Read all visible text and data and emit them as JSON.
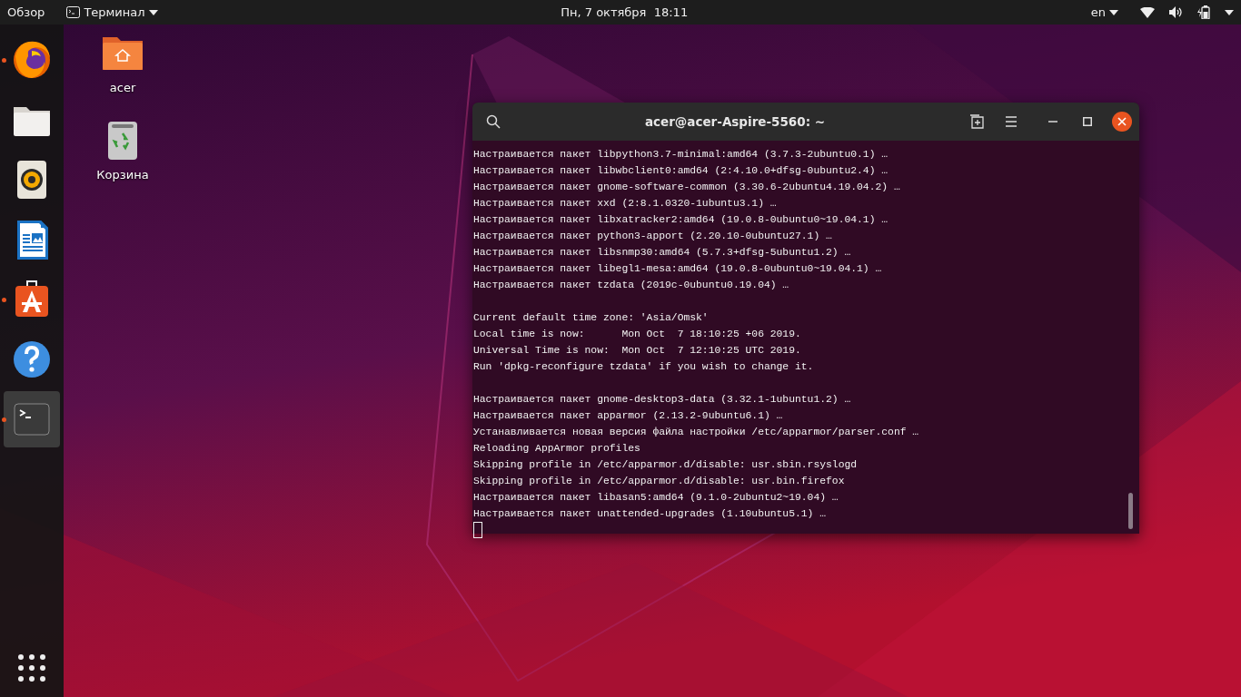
{
  "top_bar": {
    "activities": "Обзор",
    "app_menu": "Терминал",
    "clock": "Пн, 7 октября  18:11",
    "keyboard_layout": "en"
  },
  "dock": {
    "items": [
      {
        "kind": "browser",
        "running": true,
        "selected": false
      },
      {
        "kind": "files",
        "running": false,
        "selected": false
      },
      {
        "kind": "music",
        "running": false,
        "selected": false
      },
      {
        "kind": "writer",
        "running": false,
        "selected": false
      },
      {
        "kind": "software",
        "running": true,
        "selected": false
      },
      {
        "kind": "help",
        "running": false,
        "selected": false
      },
      {
        "kind": "terminal",
        "running": true,
        "selected": true
      }
    ]
  },
  "desktop_icons": [
    {
      "kind": "home",
      "label": "acer"
    },
    {
      "kind": "trash",
      "label": "Корзина"
    }
  ],
  "terminal": {
    "title": "acer@acer-Aspire-5560: ~",
    "blocks": [
      [
        "Настраивается пакет libpython3.7-minimal:amd64 (3.7.3-2ubuntu0.1) …",
        "Настраивается пакет libwbclient0:amd64 (2:4.10.0+dfsg-0ubuntu2.4) …",
        "Настраивается пакет gnome-software-common (3.30.6-2ubuntu4.19.04.2) …",
        "Настраивается пакет xxd (2:8.1.0320-1ubuntu3.1) …",
        "Настраивается пакет libxatracker2:amd64 (19.0.8-0ubuntu0~19.04.1) …",
        "Настраивается пакет python3-apport (2.20.10-0ubuntu27.1) …",
        "Настраивается пакет libsnmp30:amd64 (5.7.3+dfsg-5ubuntu1.2) …",
        "Настраивается пакет libegl1-mesa:amd64 (19.0.8-0ubuntu0~19.04.1) …",
        "Настраивается пакет tzdata (2019c-0ubuntu0.19.04) …"
      ],
      [
        "Current default time zone: 'Asia/Omsk'",
        "Local time is now:      Mon Oct  7 18:10:25 +06 2019.",
        "Universal Time is now:  Mon Oct  7 12:10:25 UTC 2019.",
        "Run 'dpkg-reconfigure tzdata' if you wish to change it."
      ],
      [
        "Настраивается пакет gnome-desktop3-data (3.32.1-1ubuntu1.2) …",
        "Настраивается пакет apparmor (2.13.2-9ubuntu6.1) …",
        "Устанавливается новая версия файла настройки /etc/apparmor/parser.conf …",
        "Reloading AppArmor profiles",
        "Skipping profile in /etc/apparmor.d/disable: usr.sbin.rsyslogd",
        "Skipping profile in /etc/apparmor.d/disable: usr.bin.firefox",
        "Настраивается пакет libasan5:amd64 (9.1.0-2ubuntu2~19.04) …",
        "Настраивается пакет unattended-upgrades (1.10ubuntu5.1) …"
      ]
    ]
  }
}
